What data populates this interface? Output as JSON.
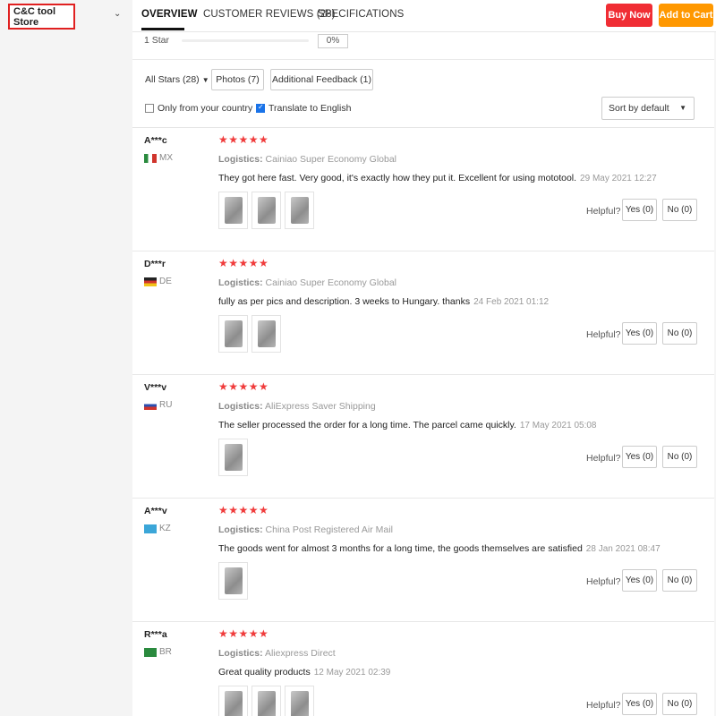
{
  "store": {
    "name": "C&C tool Store"
  },
  "tabs": [
    {
      "label": "OVERVIEW"
    },
    {
      "label": "CUSTOMER REVIEWS (28)"
    },
    {
      "label": "SPECIFICATIONS"
    }
  ],
  "actions": {
    "buy_now": "Buy Now",
    "add_to_cart": "Add to Cart"
  },
  "colors": {
    "buy_now": "#f02d34",
    "add_to_cart": "#ff9800",
    "stars": "#f03c3c",
    "checkbox": "#1a73e8"
  },
  "rating_breakdown": {
    "label": "1 Star",
    "percent": "0%"
  },
  "filters": {
    "all_stars": "All Stars (28)",
    "photos": "Photos (7)",
    "additional_feedback": "Additional Feedback (1)",
    "only_country": "Only from your country",
    "translate": "Translate to English",
    "sort": "Sort by default"
  },
  "helpful_label": "Helpful?",
  "reviews": [
    {
      "name": "A***c",
      "country": "MX",
      "stars": "★★★★★",
      "logistics_label": "Logistics:",
      "logistics": "Cainiao Super Economy Global",
      "text": "They got here fast. Very good, it's exactly how they put it. Excellent for using mototool.",
      "date": "29 May 2021 12:27",
      "photos": 3,
      "yes": "Yes (0)",
      "no": "No (0)"
    },
    {
      "name": "D***r",
      "country": "DE",
      "stars": "★★★★★",
      "logistics_label": "Logistics:",
      "logistics": "Cainiao Super Economy Global",
      "text": "fully as per pics and description. 3 weeks to Hungary. thanks",
      "date": "24 Feb 2021 01:12",
      "photos": 2,
      "yes": "Yes (0)",
      "no": "No (0)"
    },
    {
      "name": "V***v",
      "country": "RU",
      "stars": "★★★★★",
      "logistics_label": "Logistics:",
      "logistics": "AliExpress Saver Shipping",
      "text": "The seller processed the order for a long time. The parcel came quickly.",
      "date": "17 May 2021 05:08",
      "photos": 1,
      "yes": "Yes (0)",
      "no": "No (0)"
    },
    {
      "name": "A***v",
      "country": "KZ",
      "stars": "★★★★★",
      "logistics_label": "Logistics:",
      "logistics": "China Post Registered Air Mail",
      "text": "The goods went for almost 3 months for a long time, the goods themselves are satisfied",
      "date": "28 Jan 2021 08:47",
      "photos": 1,
      "yes": "Yes (0)",
      "no": "No (0)"
    },
    {
      "name": "R***a",
      "country": "BR",
      "stars": "★★★★★",
      "logistics_label": "Logistics:",
      "logistics": "Aliexpress Direct",
      "text": "Great quality products",
      "date": "12 May 2021 02:39",
      "photos": 3,
      "yes": "Yes (0)",
      "no": "No (0)"
    }
  ]
}
